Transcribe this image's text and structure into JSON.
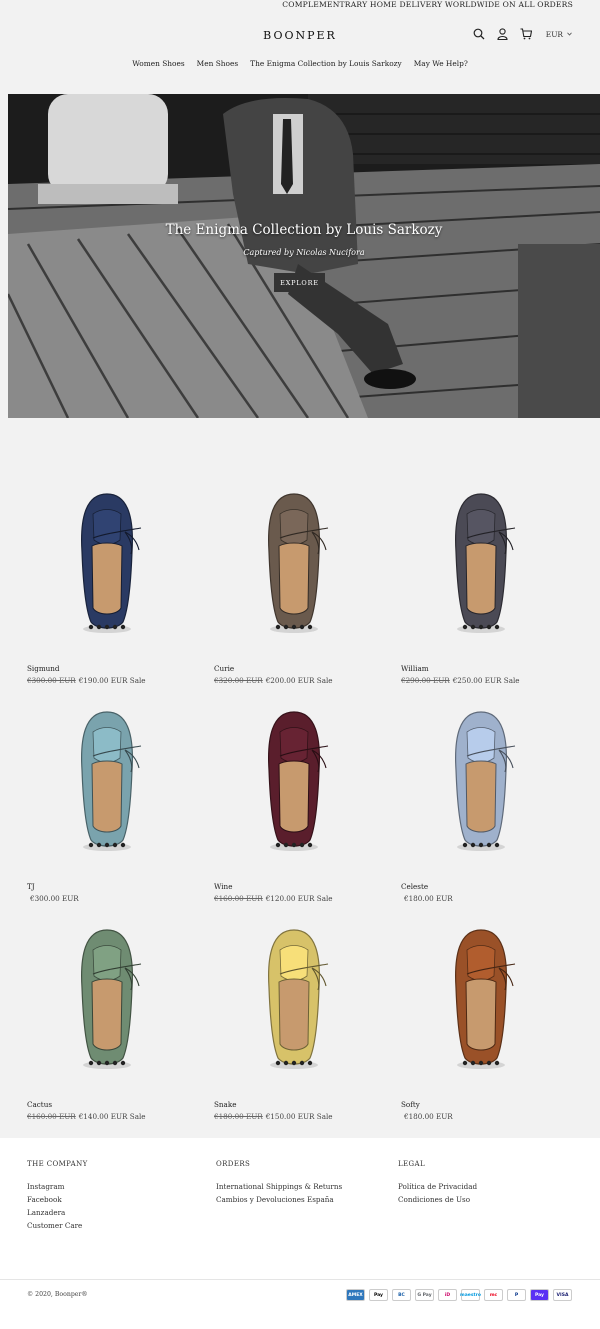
{
  "announcement": "COMPLEMENTRARY HOME DELIVERY WORLDWIDE ON ALL ORDERS",
  "logo": "BOONPER",
  "header": {
    "currency": "EUR",
    "icons": [
      "search-icon",
      "account-icon",
      "cart-icon",
      "chevron-down-icon"
    ]
  },
  "nav": [
    "Women Shoes",
    "Men Shoes",
    "The Enigma Collection by Louis Sarkozy",
    "May We Help?"
  ],
  "hero": {
    "title": "The Enigma Collection by Louis Sarkozy",
    "subtitle": "Captured by Nicolas Nucifora",
    "button": "EXPLORE"
  },
  "products": [
    {
      "name": "Sigmund",
      "compare_price": "€300.00 EUR",
      "price": "€190.00 EUR",
      "sale": "Sale",
      "color": "#2a3a63"
    },
    {
      "name": "Curie",
      "compare_price": "€320.00 EUR",
      "price": "€200.00 EUR",
      "sale": "Sale",
      "color": "#6a5a4d"
    },
    {
      "name": "William",
      "compare_price": "€290.00 EUR",
      "price": "€250.00 EUR",
      "sale": "Sale",
      "color": "#4b4a55"
    },
    {
      "name": "TJ",
      "compare_price": "",
      "price": "€300.00 EUR",
      "sale": "",
      "color": "#7aa3ad"
    },
    {
      "name": "Wine",
      "compare_price": "€160.00 EUR",
      "price": "€120.00 EUR",
      "sale": "Sale",
      "color": "#5a1e2c"
    },
    {
      "name": "Celeste",
      "compare_price": "",
      "price": "€180.00 EUR",
      "sale": "",
      "color": "#9fb1cc"
    },
    {
      "name": "Cactus",
      "compare_price": "€160.00 EUR",
      "price": "€140.00 EUR",
      "sale": "Sale",
      "color": "#6f8c72"
    },
    {
      "name": "Snake",
      "compare_price": "€180.00 EUR",
      "price": "€150.00 EUR",
      "sale": "Sale",
      "color": "#d7c269"
    },
    {
      "name": "Softy",
      "compare_price": "",
      "price": "€180.00 EUR",
      "sale": "",
      "color": "#9a5128"
    }
  ],
  "footer": {
    "company": {
      "heading": "THE COMPANY",
      "links": [
        "Instagram",
        "Facebook",
        "Lanzadera",
        "Customer Care"
      ]
    },
    "orders": {
      "heading": "ORDERS",
      "links": [
        "International Shippings & Returns",
        "Cambios y Devoluciones España"
      ]
    },
    "legal": {
      "heading": "LEGAL",
      "links": [
        "Política de Privacidad",
        "Condiciones de Uso"
      ]
    },
    "copyright": "© 2020, Boonper®",
    "payments": [
      {
        "name": "AMEX",
        "bg": "#2e77bc",
        "fg": "#ffffff"
      },
      {
        "name": "Pay",
        "bg": "#ffffff",
        "fg": "#000000"
      },
      {
        "name": "BC",
        "bg": "#ffffff",
        "fg": "#1a5fa8"
      },
      {
        "name": "G Pay",
        "bg": "#ffffff",
        "fg": "#5f6368"
      },
      {
        "name": "iD",
        "bg": "#ffffff",
        "fg": "#cc0066"
      },
      {
        "name": "maestro",
        "bg": "#ffffff",
        "fg": "#0099df"
      },
      {
        "name": "mc",
        "bg": "#ffffff",
        "fg": "#eb001b"
      },
      {
        "name": "P",
        "bg": "#ffffff",
        "fg": "#003087"
      },
      {
        "name": "Pay",
        "bg": "#5a31f4",
        "fg": "#ffffff"
      },
      {
        "name": "VISA",
        "bg": "#ffffff",
        "fg": "#1a1f71"
      }
    ]
  }
}
